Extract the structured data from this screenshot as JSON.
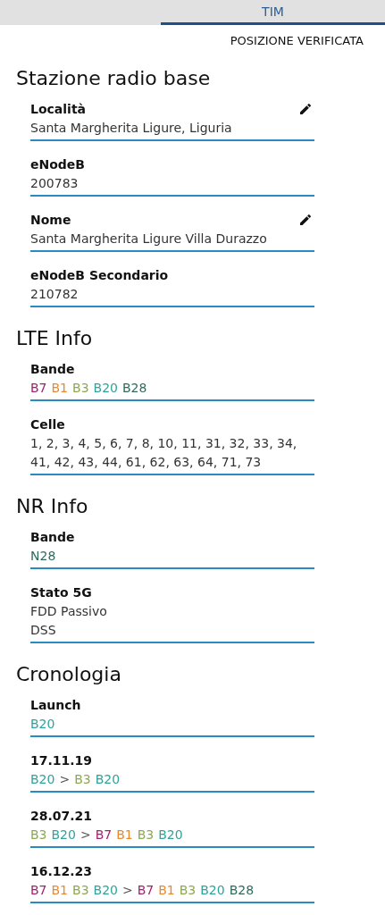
{
  "tabs": [
    {
      "label": "TIM",
      "selected": true
    }
  ],
  "status_button": "POSIZIONE VERIFICATA",
  "sections": [
    {
      "title": "Stazione radio base",
      "fields": [
        {
          "label": "Località",
          "kind": "text",
          "editable": true,
          "lines": [
            "Santa Margherita Ligure, Liguria"
          ]
        },
        {
          "label": "eNodeB",
          "kind": "text",
          "editable": false,
          "lines": [
            "200783"
          ]
        },
        {
          "label": "Nome",
          "kind": "text",
          "editable": true,
          "lines": [
            "Santa Margherita Ligure Villa Durazzo"
          ]
        },
        {
          "label": "eNodeB Secondario",
          "kind": "text",
          "editable": false,
          "lines": [
            "210782"
          ]
        }
      ]
    },
    {
      "title": "LTE Info",
      "fields": [
        {
          "label": "Bande",
          "kind": "bands",
          "editable": false,
          "tokens": [
            {
              "kind": "band",
              "text": "B7",
              "color": "#a3206e"
            },
            {
              "kind": "band",
              "text": "B1",
              "color": "#e8892c"
            },
            {
              "kind": "band",
              "text": "B3",
              "color": "#8ea84f"
            },
            {
              "kind": "band",
              "text": "B20",
              "color": "#2fa39a"
            },
            {
              "kind": "band",
              "text": "B28",
              "color": "#2e6b5c"
            }
          ]
        },
        {
          "label": "Celle",
          "kind": "text",
          "editable": false,
          "lines": [
            "1, 2, 3, 4, 5, 6, 7, 8, 10, 11, 31, 32, 33, 34, 41, 42, 43, 44, 61, 62, 63, 64, 71, 73"
          ]
        }
      ]
    },
    {
      "title": "NR Info",
      "fields": [
        {
          "label": "Bande",
          "kind": "bands",
          "editable": false,
          "tokens": [
            {
              "kind": "band",
              "text": "N28",
              "color": "#2e6b5c"
            }
          ]
        },
        {
          "label": "Stato 5G",
          "kind": "text",
          "editable": false,
          "lines": [
            "FDD Passivo",
            "DSS"
          ]
        }
      ]
    },
    {
      "title": "Cronologia",
      "fields": [
        {
          "label": "Launch",
          "kind": "bands",
          "editable": false,
          "tokens": [
            {
              "kind": "band",
              "text": "B20",
              "color": "#2fa39a"
            }
          ]
        },
        {
          "label": "17.11.19",
          "kind": "bands",
          "editable": false,
          "tokens": [
            {
              "kind": "band",
              "text": "B20",
              "color": "#2fa39a"
            },
            {
              "kind": "separator",
              "text": ">"
            },
            {
              "kind": "band",
              "text": "B3",
              "color": "#8ea84f"
            },
            {
              "kind": "band",
              "text": "B20",
              "color": "#2fa39a"
            }
          ]
        },
        {
          "label": "28.07.21",
          "kind": "bands",
          "editable": false,
          "tokens": [
            {
              "kind": "band",
              "text": "B3",
              "color": "#8ea84f"
            },
            {
              "kind": "band",
              "text": "B20",
              "color": "#2fa39a"
            },
            {
              "kind": "separator",
              "text": ">"
            },
            {
              "kind": "band",
              "text": "B7",
              "color": "#a3206e"
            },
            {
              "kind": "band",
              "text": "B1",
              "color": "#e8892c"
            },
            {
              "kind": "band",
              "text": "B3",
              "color": "#8ea84f"
            },
            {
              "kind": "band",
              "text": "B20",
              "color": "#2fa39a"
            }
          ]
        },
        {
          "label": "16.12.23",
          "kind": "bands",
          "editable": false,
          "tokens": [
            {
              "kind": "band",
              "text": "B7",
              "color": "#a3206e"
            },
            {
              "kind": "band",
              "text": "B1",
              "color": "#e8892c"
            },
            {
              "kind": "band",
              "text": "B3",
              "color": "#8ea84f"
            },
            {
              "kind": "band",
              "text": "B20",
              "color": "#2fa39a"
            },
            {
              "kind": "separator",
              "text": ">"
            },
            {
              "kind": "band",
              "text": "B7",
              "color": "#a3206e"
            },
            {
              "kind": "band",
              "text": "B1",
              "color": "#e8892c"
            },
            {
              "kind": "band",
              "text": "B3",
              "color": "#8ea84f"
            },
            {
              "kind": "band",
              "text": "B20",
              "color": "#2fa39a"
            },
            {
              "kind": "band",
              "text": "B28",
              "color": "#2e6b5c"
            }
          ]
        }
      ]
    }
  ]
}
